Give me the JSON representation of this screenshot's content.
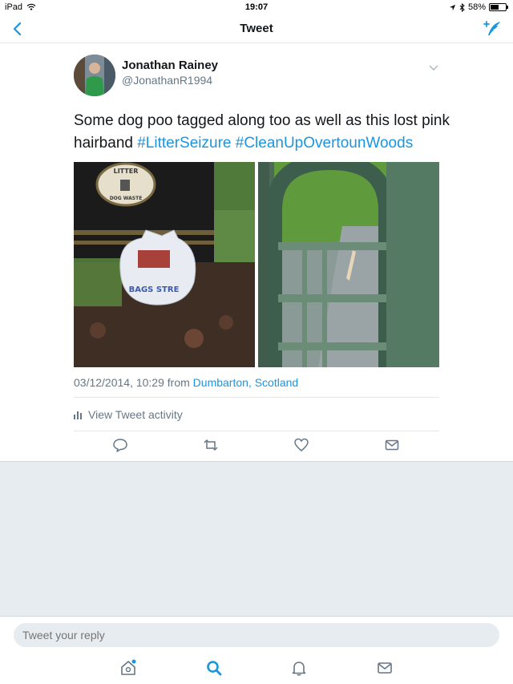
{
  "status": {
    "device": "iPad",
    "time": "19:07",
    "battery": "58%",
    "battery_level": 0.58
  },
  "nav": {
    "title": "Tweet"
  },
  "tweet": {
    "author_name": "Jonathan Rainey",
    "author_handle": "@JonathanR1994",
    "text_plain": "Some dog poo tagged along too as well as this lost pink hairband ",
    "hashtags": [
      "#LitterSeizure",
      "#CleanUpOvertounWoods"
    ],
    "bin_label_top": "LITTER",
    "bin_label_bottom": "DOG WASTE",
    "bag_text": "BAGS STRE",
    "timestamp": "03/12/2014, 10:29 from ",
    "location": "Dumbarton, Scotland",
    "activity_label": "View Tweet activity"
  },
  "reply": {
    "placeholder": "Tweet your reply"
  },
  "icons": {
    "back": "chevron-left-icon",
    "compose": "compose-icon",
    "reply": "reply-icon",
    "retweet": "retweet-icon",
    "like": "heart-icon",
    "dm": "envelope-icon",
    "home": "home-icon",
    "search": "search-icon",
    "notifications": "bell-icon",
    "messages": "envelope-icon"
  },
  "colors": {
    "accent": "#1b95e0",
    "muted": "#657786",
    "background_gray": "#e6ecf0"
  }
}
